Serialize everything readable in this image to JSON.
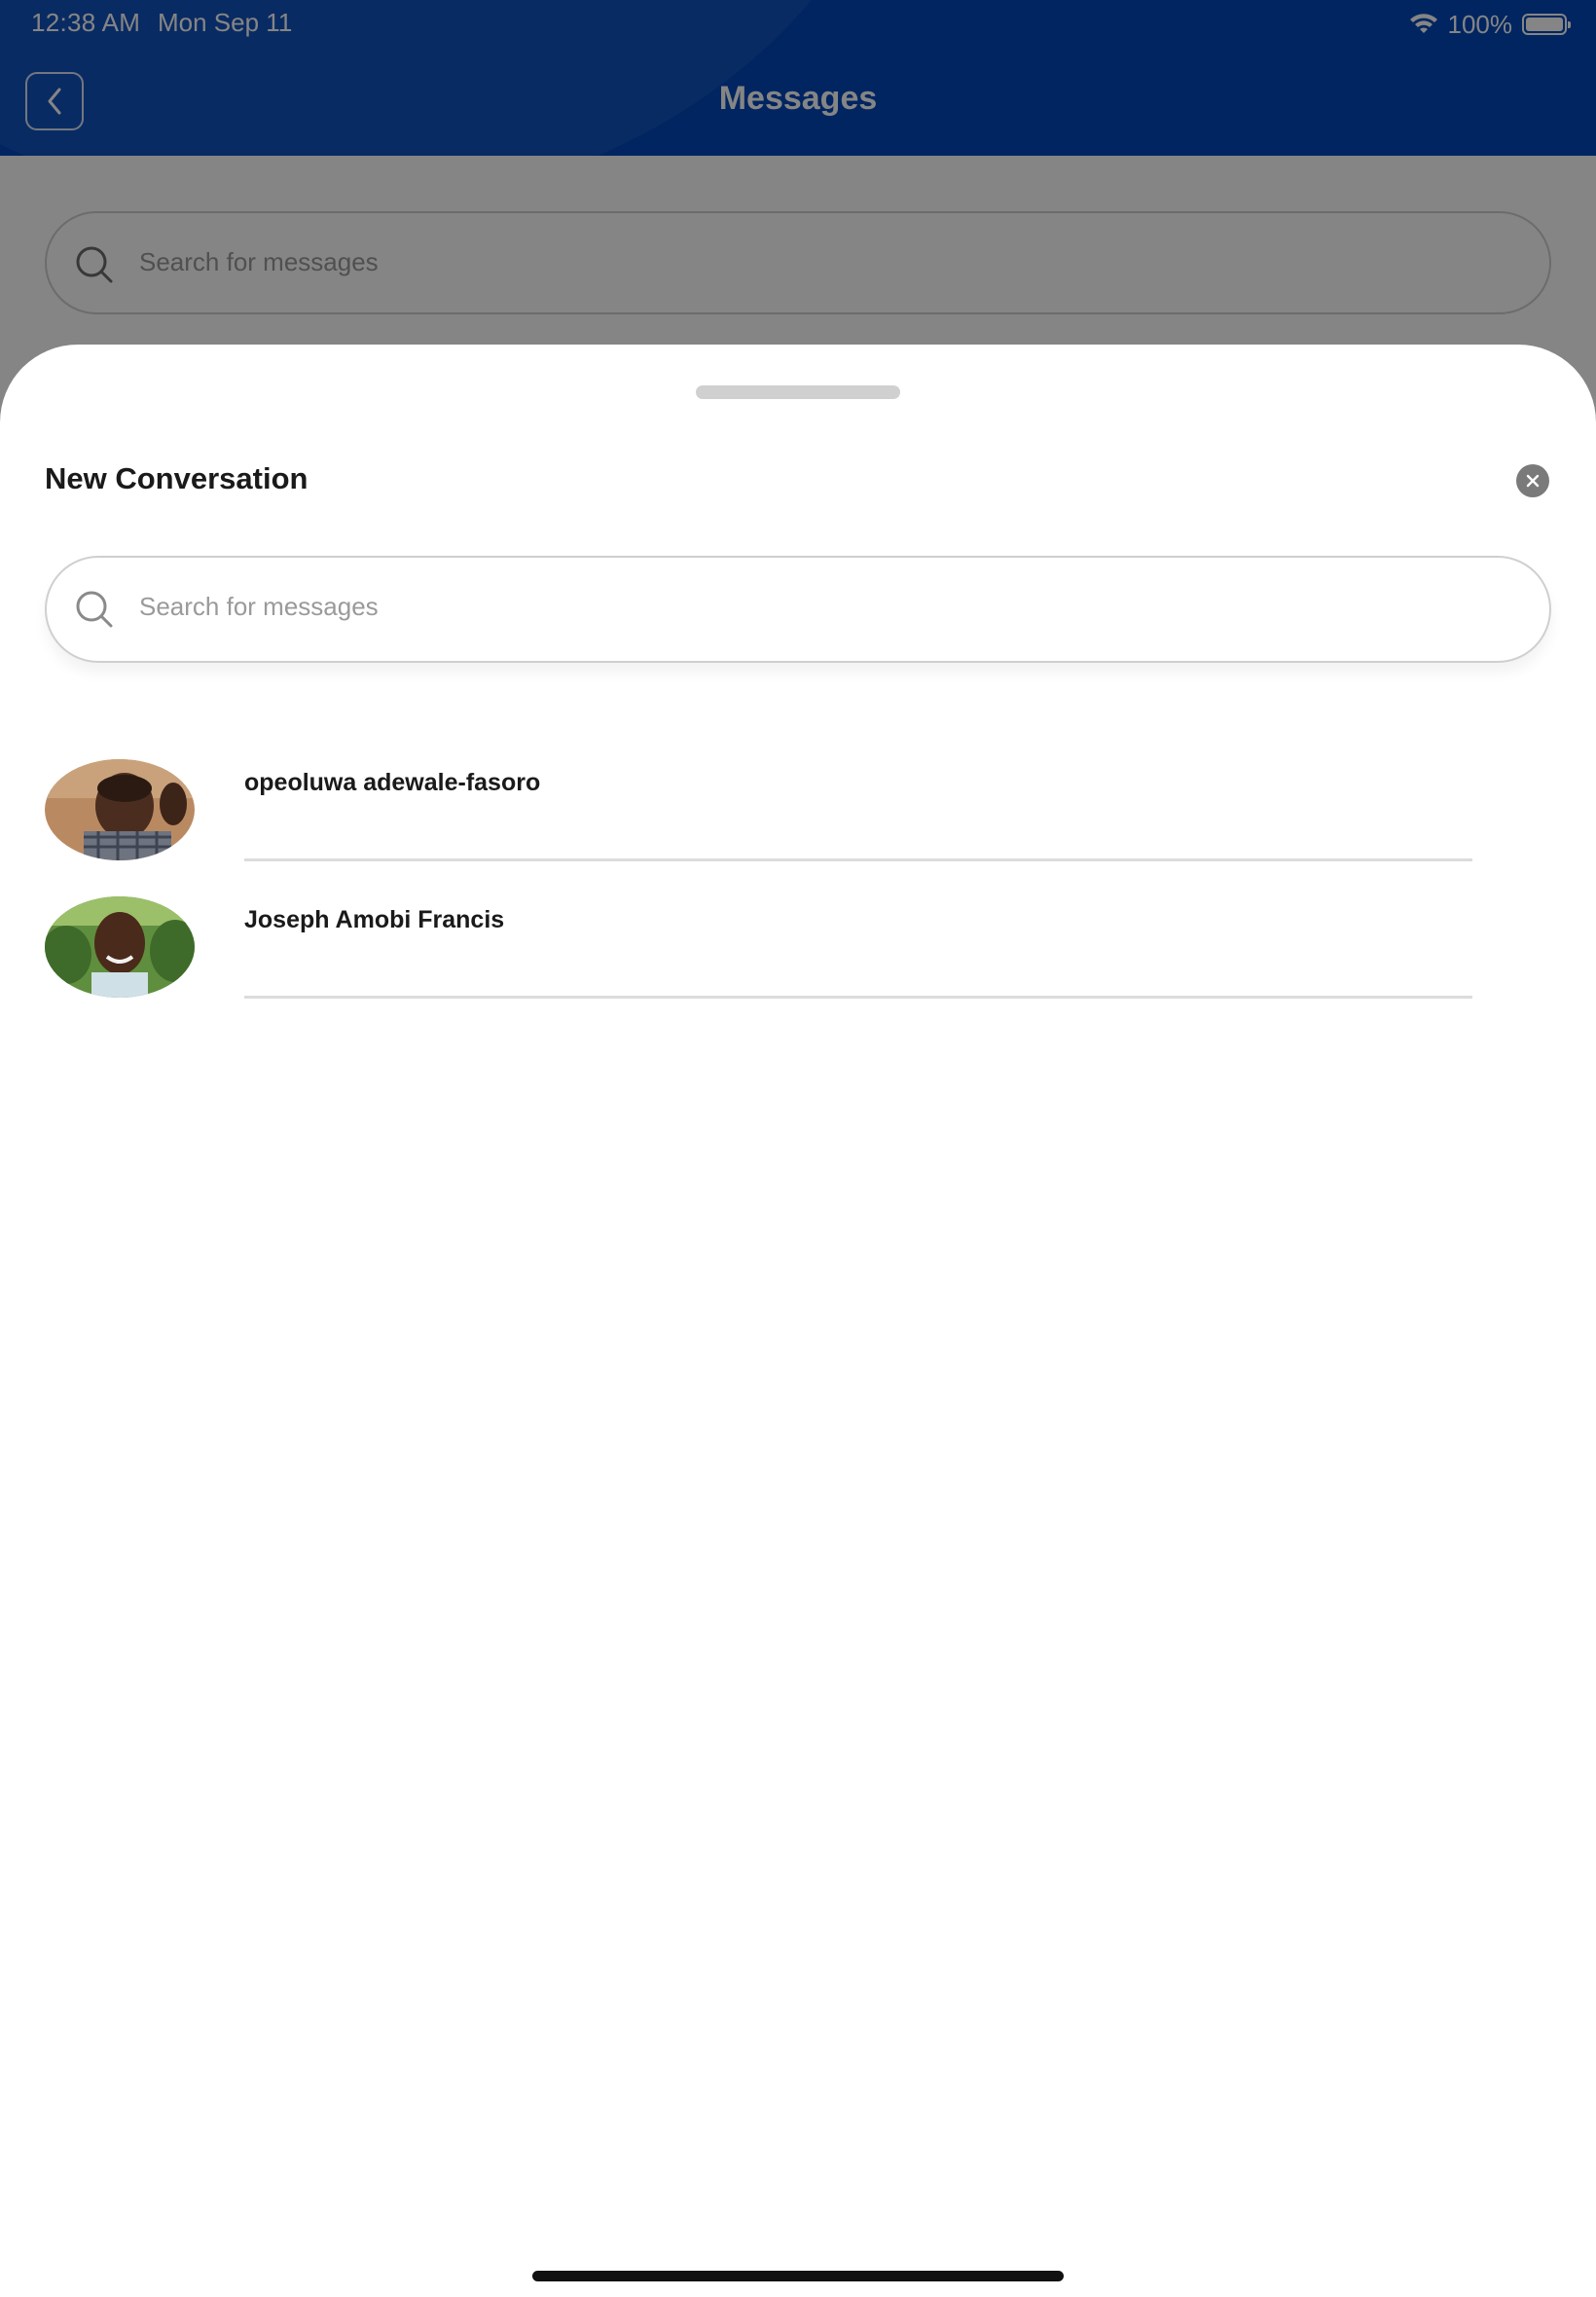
{
  "status_bar": {
    "time": "12:38 AM",
    "date": "Mon Sep 11",
    "battery": "100%"
  },
  "header": {
    "title": "Messages",
    "back_icon": "chevron-left-icon"
  },
  "background_search": {
    "placeholder": "Search for messages"
  },
  "sheet": {
    "title": "New Conversation",
    "close_icon": "close-icon",
    "search": {
      "placeholder": "Search for messages"
    },
    "contacts": [
      {
        "name": "opeoluwa adewale-fasoro"
      },
      {
        "name": "Joseph Amobi Francis"
      }
    ]
  },
  "colors": {
    "header_blue": "#0047bb",
    "overlay": "rgba(0,0,0,0.48)"
  }
}
